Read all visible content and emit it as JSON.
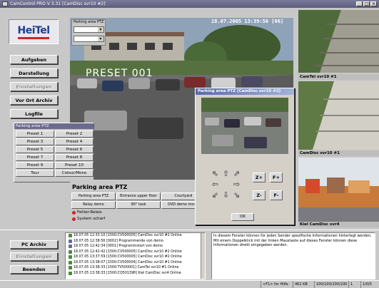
{
  "window": {
    "title": "CamControl PRO   V 3.31  [CamDisc svr10 #2]",
    "controls": [
      "_",
      "□",
      "×"
    ]
  },
  "logo": {
    "text": "HeiTel"
  },
  "left_buttons": [
    {
      "label": "Aufgeben",
      "disabled": false
    },
    {
      "label": "Darstellung",
      "disabled": false
    },
    {
      "label": "Einstellungen",
      "disabled": true
    },
    {
      "label": "Vor Ort Archiv",
      "disabled": false
    },
    {
      "label": "Logfile",
      "disabled": false
    }
  ],
  "main_video": {
    "overlay_label": "Parking area PTZ",
    "timestamp": "18.07.2005 13:39:56 [06]",
    "preset_text": "PRESET 001"
  },
  "side_cams": [
    {
      "caption": "CamTel svr10 #1"
    },
    {
      "caption": "CamDisc svr10 #1"
    },
    {
      "caption": "Kiel CamDisc svr4"
    }
  ],
  "ptz_presets": {
    "header": "Parking area PTZ",
    "buttons": [
      "Preset 1",
      "Preset 2",
      "Preset 3",
      "Preset 4",
      "Preset 5",
      "Preset 6",
      "Preset 7",
      "Preset 8",
      "Preset 9",
      "Preset 10",
      "Tour",
      "Colour/Mono"
    ]
  },
  "camera_panel": {
    "title": "Parking area PTZ",
    "positions": [
      "Parking area PTZ",
      "Entrance upper floor",
      "Courtyard",
      "",
      "Relay demo",
      "90° task",
      "DVD demo movie",
      ""
    ],
    "status": [
      {
        "label": "Fehler-Relais"
      },
      {
        "label": "System scharf"
      }
    ]
  },
  "ptz_dialog": {
    "title": "Parking area PTZ [CamDisc svr10 #2]",
    "arrows": [
      "⇖",
      "⇧",
      "⇗",
      "⇦",
      "",
      "⇨",
      "⇙",
      "⇩",
      "⇘"
    ],
    "zoom_buttons": [
      "Z+",
      "F+",
      "Z-",
      "F-"
    ],
    "ok_label": "OK"
  },
  "bottom_buttons": [
    {
      "label": "PC Archiv",
      "disabled": false
    },
    {
      "label": "Einstellungen",
      "disabled": true
    },
    {
      "label": "Beenden",
      "disabled": false
    }
  ],
  "log": [
    "18.07.05 12:33:10 [1500:CV500005] CamDisc svr10 #2 Online",
    "18.07.05 12:38:56 [0002] Programmende von demo",
    "18.07.05 12:42:34 [0001] Programmstart von demo",
    "18.07.05 12:42:42 [1500:CV500005] CamDisc svr10 #2 Online",
    "18.07.05 13:37:59 [1500:CV500005] CamDisc svr10 #2 Online",
    "18.07.05 13:38:07 [1500:CV500004] CamDisc svr10 #1 Online",
    "18.07.05 13:38:33 [1500:TV500001] CamTel svr10 #1 Online",
    "18.07.05 13:38:33 [1500:CQ501398] Kiel CamDisc svr4 Online"
  ],
  "info_text": "In diesem Fenster können für jeden Sender spezifische Informationen hinterlegt werden. Mit einem Doppelklick mit der linken Maustaste auf dieses Fenster können diese Informationen direkt eingegeben werden.",
  "statusbar": {
    "help": "<F1> for Hilfe",
    "size": "462 KB",
    "rate": "100/100/100/100",
    "page": "1",
    "ratio": "1/0/5"
  }
}
